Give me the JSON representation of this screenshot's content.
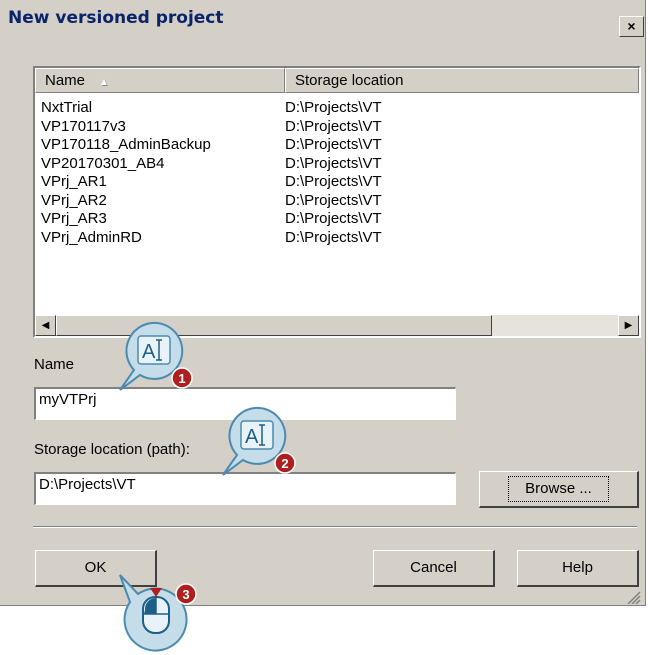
{
  "dialog": {
    "title": "New versioned project",
    "close_label": "×"
  },
  "list": {
    "columns": [
      "Name",
      "Storage location"
    ],
    "rows": [
      {
        "name": "NxtTrial",
        "location": "D:\\Projects\\VT"
      },
      {
        "name": "VP170117v3",
        "location": "D:\\Projects\\VT"
      },
      {
        "name": "VP170118_AdminBackup",
        "location": "D:\\Projects\\VT"
      },
      {
        "name": "VP20170301_AB4",
        "location": "D:\\Projects\\VT"
      },
      {
        "name": "VPrj_AR1",
        "location": "D:\\Projects\\VT"
      },
      {
        "name": "VPrj_AR2",
        "location": "D:\\Projects\\VT"
      },
      {
        "name": "VPrj_AR3",
        "location": "D:\\Projects\\VT"
      },
      {
        "name": "VPrj_AdminRD",
        "location": "D:\\Projects\\VT"
      }
    ]
  },
  "form": {
    "name_label": "Name",
    "name_value": "myVTPrj",
    "path_label": "Storage location (path):",
    "path_value": "D:\\Projects\\VT",
    "browse_label": "Browse ..."
  },
  "buttons": {
    "ok": "OK",
    "cancel": "Cancel",
    "help": "Help"
  },
  "callouts": [
    "1",
    "2",
    "3"
  ],
  "icons": {
    "text_cursor": "text-cursor-icon",
    "mouse": "mouse-icon"
  },
  "colors": {
    "face": "#d4d0c8",
    "title_text": "#0a246a",
    "callout_fill": "#c5dce9",
    "callout_stroke": "#4a8bb0",
    "badge": "#b01f1f"
  }
}
